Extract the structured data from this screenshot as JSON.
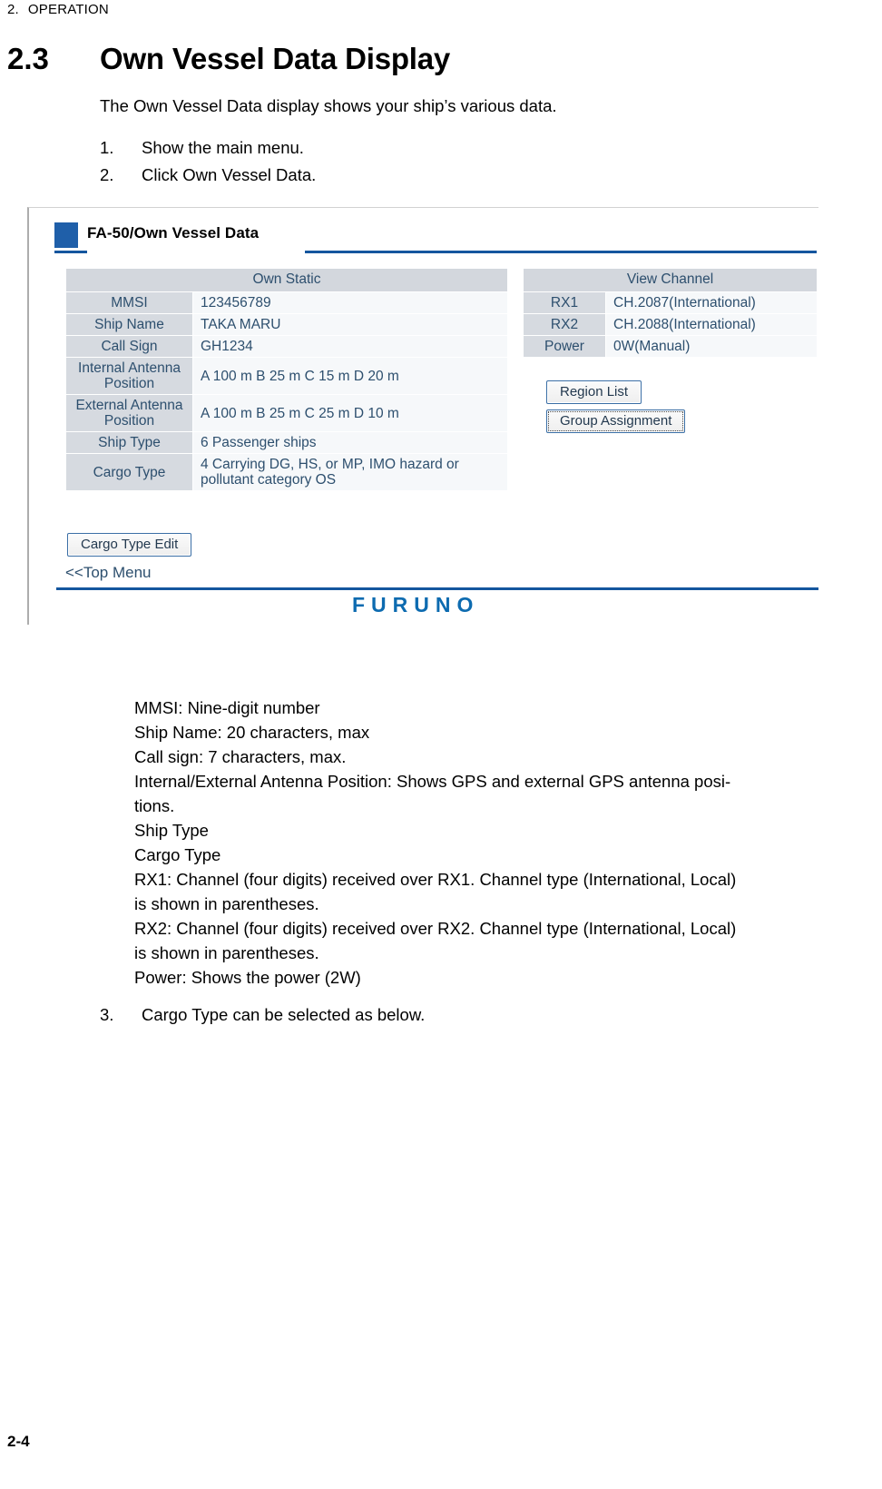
{
  "running_header": {
    "chapter_number": "2.",
    "chapter_title": "OPERATION"
  },
  "section": {
    "number": "2.3",
    "title": "Own Vessel Data Display",
    "intro": "The Own Vessel Data display shows your ship’s various data."
  },
  "steps": [
    {
      "number": "1.",
      "text": "Show the main menu."
    },
    {
      "number": "2.",
      "text": "Click Own Vessel Data."
    },
    {
      "number": "3.",
      "text": "Cargo Type can be selected as below."
    }
  ],
  "screenshot": {
    "page_title": "FA-50/Own Vessel Data",
    "own_static": {
      "header": "Own Static",
      "rows": [
        {
          "label": "MMSI",
          "value": "123456789"
        },
        {
          "label": "Ship Name",
          "value": "TAKA MARU"
        },
        {
          "label": "Call Sign",
          "value": "GH1234"
        },
        {
          "label": "Internal Antenna Position",
          "value": "A 100 m B 25 m C 15 m D 20 m"
        },
        {
          "label": "External Antenna Position",
          "value": "A 100 m B 25 m C 25 m D 10 m"
        },
        {
          "label": "Ship Type",
          "value": "6 Passenger ships"
        },
        {
          "label": "Cargo Type",
          "value": "4 Carrying DG, HS, or MP, IMO hazard or pollutant category OS"
        }
      ]
    },
    "view_channel": {
      "header": "View Channel",
      "rows": [
        {
          "label": "RX1",
          "value": "CH.2087(International)"
        },
        {
          "label": "RX2",
          "value": "CH.2088(International)"
        },
        {
          "label": "Power",
          "value": "0W(Manual)"
        }
      ]
    },
    "buttons": {
      "region_list": "Region List",
      "group_assignment": "Group Assignment",
      "cargo_type_edit": "Cargo Type Edit"
    },
    "top_menu_link": "<<Top Menu",
    "brand": "FURUNO",
    "colors": {
      "title_rule": "#14569e",
      "title_block": "#1f5fa9",
      "brand": "#0d6bb0",
      "table_header_bg": "#d3d7dd",
      "table_label_bg": "#d6dae0",
      "table_value_bg": "#f6f8fa",
      "table_text": "#2d4f6e"
    }
  },
  "explanation": {
    "lines": [
      "MMSI: Nine-digit number",
      "Ship Name: 20 characters, max",
      "Call sign: 7 characters, max.",
      "Internal/External Antenna Position: Shows GPS and external GPS antenna posi-\ntions.",
      "Ship Type",
      "Cargo Type",
      "RX1: Channel (four digits) received over RX1. Channel type (International, Local)\nis shown in parentheses.",
      "RX2: Channel (four digits) received over RX2. Channel type (International, Local)\nis shown in parentheses.",
      "Power: Shows the power (2W)"
    ]
  },
  "footer": {
    "page_number": "2-4"
  }
}
